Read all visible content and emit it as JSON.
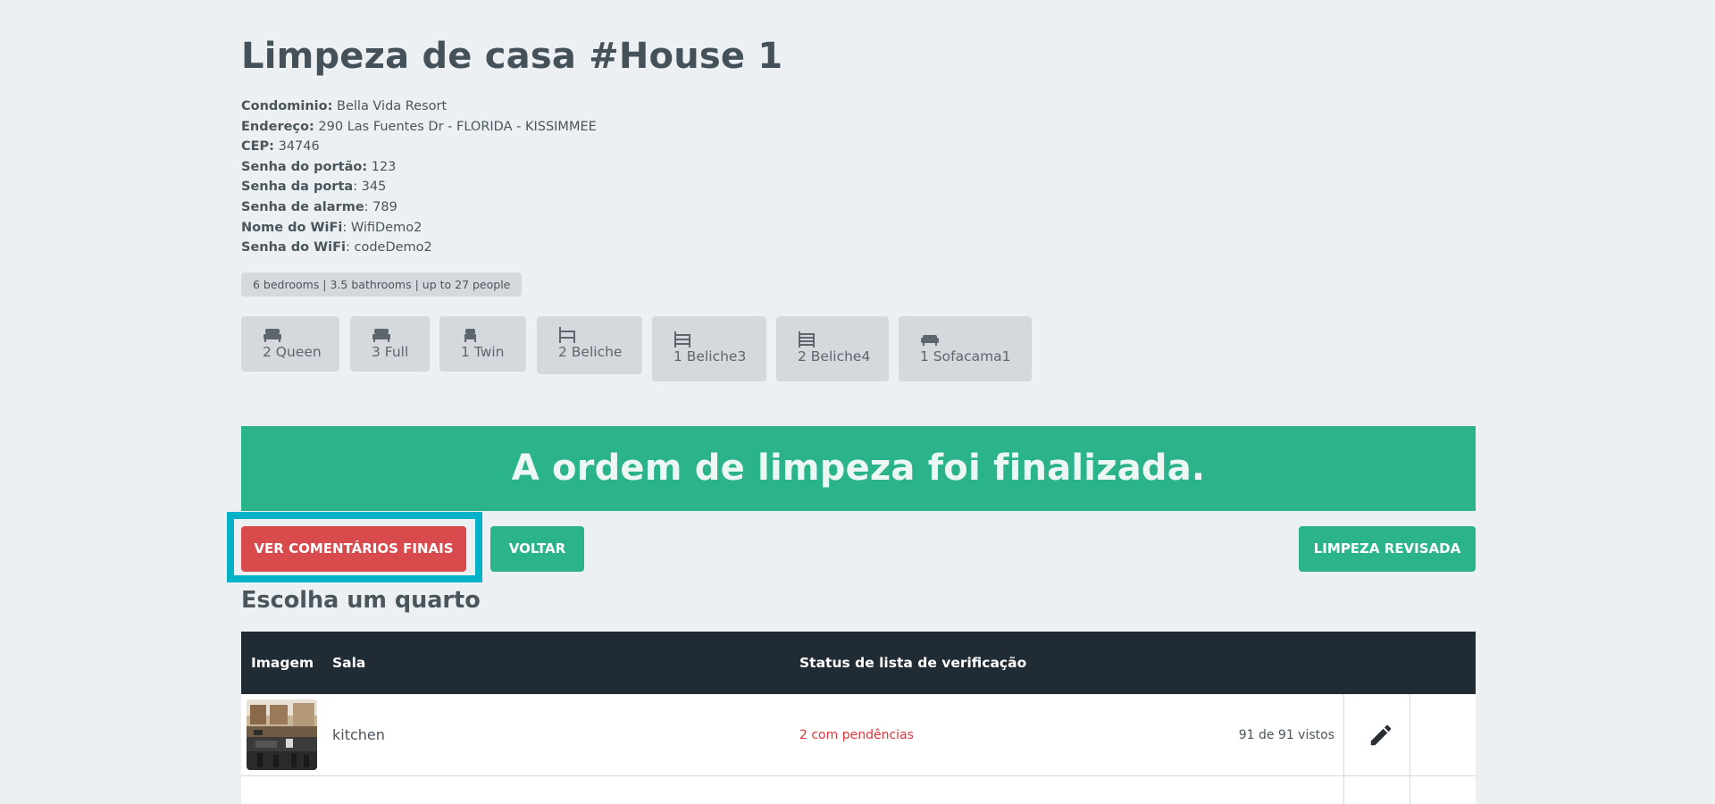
{
  "page": {
    "title": "Limpeza de casa #House 1"
  },
  "info": [
    {
      "key": "Condominio:",
      "value": " Bella Vida Resort"
    },
    {
      "key": "Endereço:",
      "value": " 290 Las Fuentes Dr - FLORIDA - KISSIMMEE"
    },
    {
      "key": "CEP:",
      "value": " 34746"
    },
    {
      "key": "Senha do portão:",
      "value": " 123"
    },
    {
      "key": "Senha da porta",
      "value": ": 345"
    },
    {
      "key": "Senha de alarme",
      "value": ": 789"
    },
    {
      "key": "Nome do WiFi",
      "value": ": WifiDemo2"
    },
    {
      "key": "Senha do WiFi",
      "value": ": codeDemo2"
    }
  ],
  "summary": "6 bedrooms | 3.5 bathrooms | up to 27 people",
  "beds": [
    {
      "label": "2 Queen",
      "icon": "bed-icon"
    },
    {
      "label": "3 Full",
      "icon": "bed-icon"
    },
    {
      "label": "1 Twin",
      "icon": "single-bed-icon"
    },
    {
      "label": "2 Beliche",
      "icon": "bunk-bed-icon"
    },
    {
      "label": "1 Beliche3",
      "icon": "triple-bunk-icon"
    },
    {
      "label": "2 Beliche4",
      "icon": "quad-bunk-icon"
    },
    {
      "label": "1 Sofacama1",
      "icon": "sofa-bed-icon"
    }
  ],
  "banner": "A ordem de limpeza foi finalizada.",
  "buttons": {
    "final_comments": "VER COMENTÁRIOS FINAIS",
    "back": "VOLTAR",
    "reviewed": "LIMPEZA REVISADA"
  },
  "section_title": "Escolha um quarto",
  "table": {
    "headers": {
      "image": "Imagem",
      "room": "Sala",
      "status": "Status de lista de verificação"
    },
    "rows": [
      {
        "room": "kitchen",
        "status": "2 com pendências",
        "count": "91 de 91 vistos",
        "action_icon": "pencil-icon"
      }
    ]
  },
  "colors": {
    "background": "#ecf0f3",
    "accent_green": "#2bb38b",
    "danger_red": "#d94a4d",
    "highlight": "#00b2c7",
    "table_header": "#212b34",
    "status_red": "#e0343b"
  }
}
